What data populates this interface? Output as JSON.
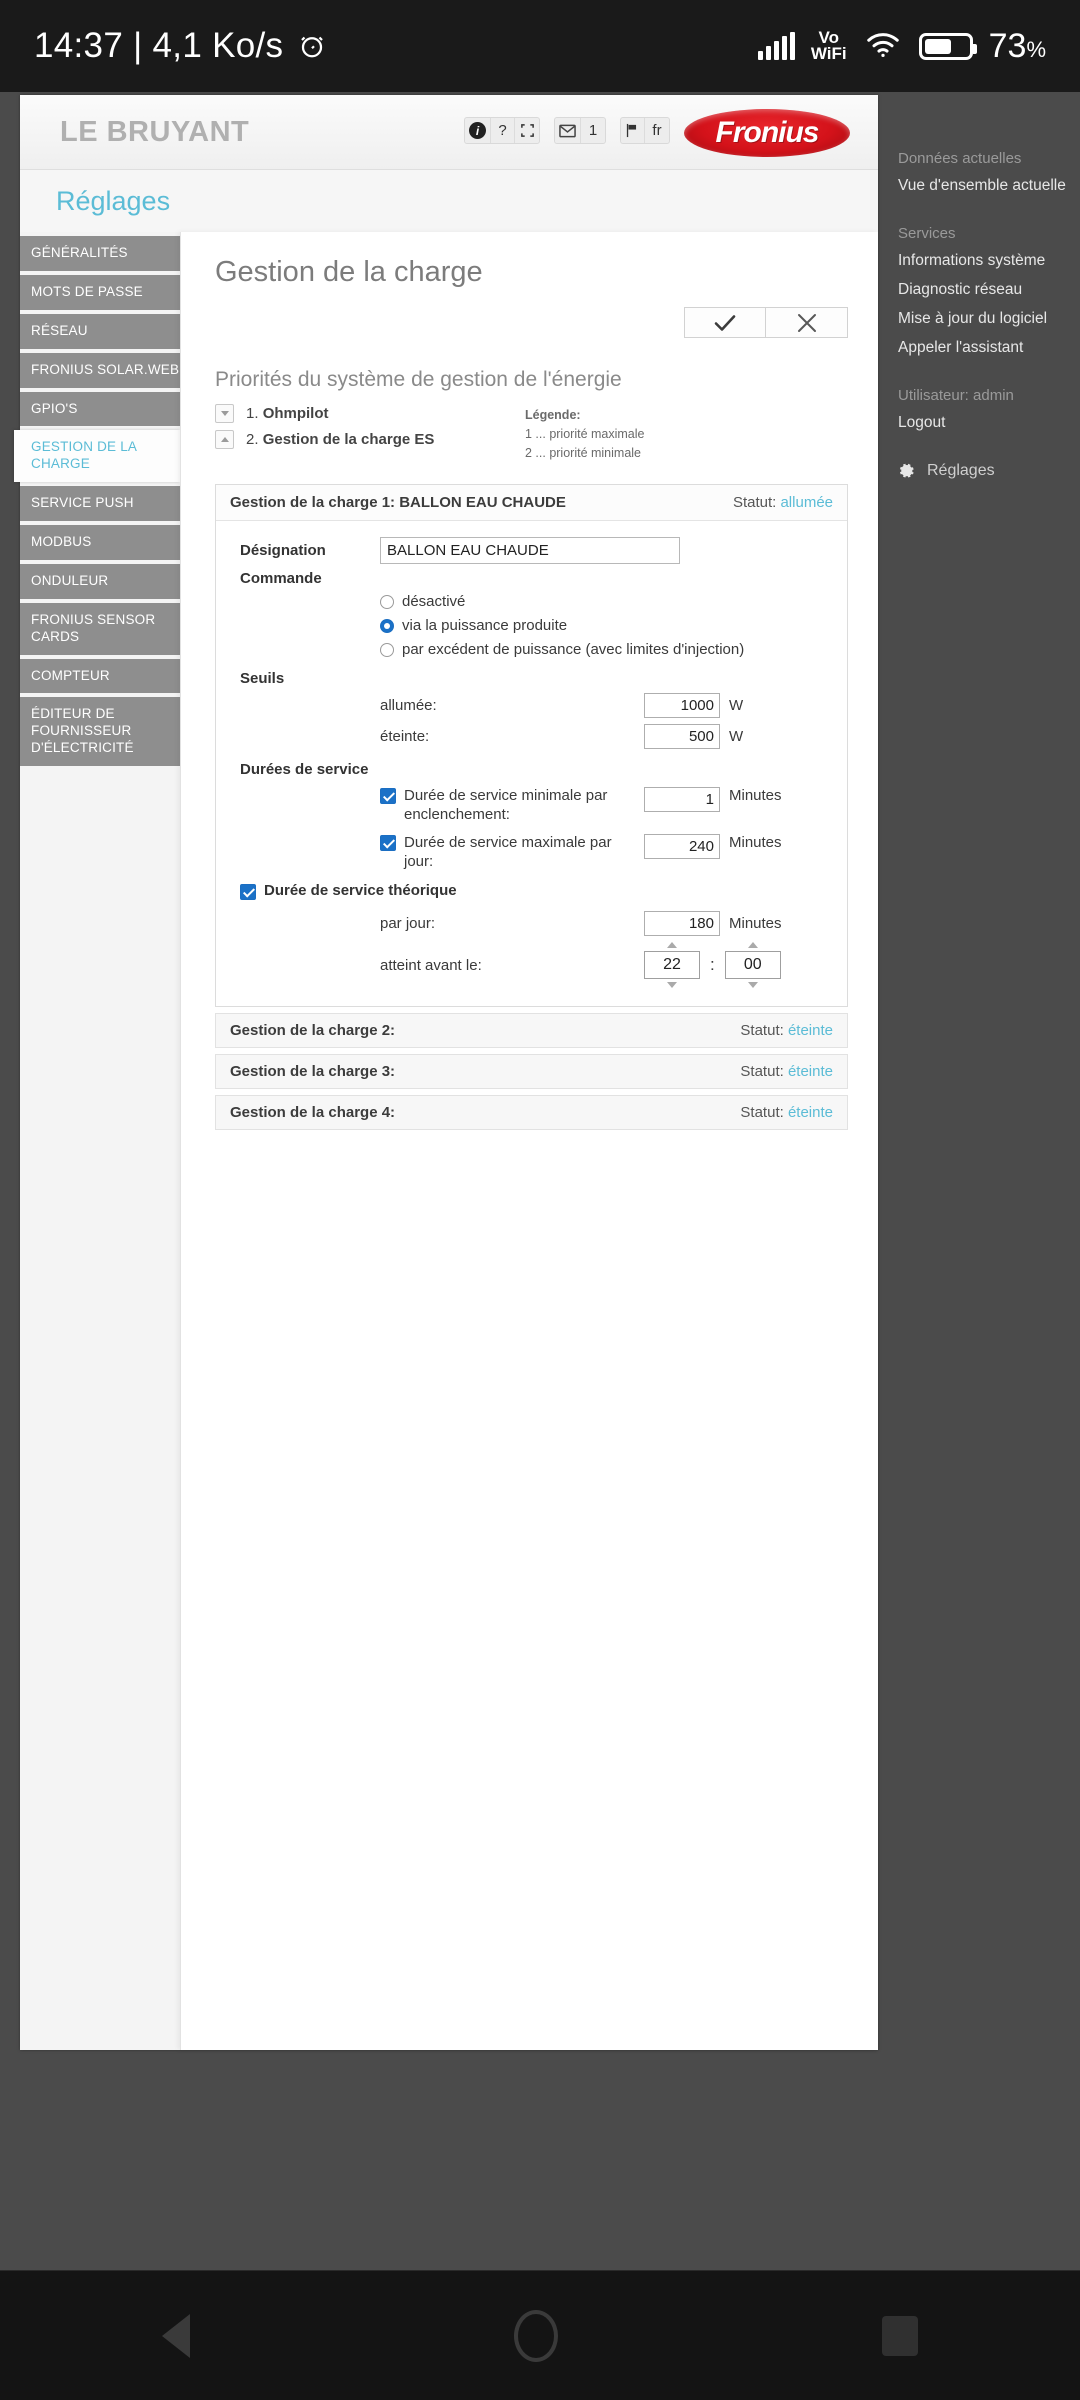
{
  "statusbar": {
    "clock": "14:37 | 4,1 Ko/s",
    "alarm_icon": "alarm-clock-icon",
    "signal_icon": "cellular-signal-icon",
    "vowifi_line1": "Vo",
    "vowifi_line2": "WiFi",
    "wifi_icon": "wifi-icon",
    "battery_icon": "battery-icon",
    "battery_percent": "73",
    "percent_sign": "%"
  },
  "header": {
    "site_title": "LE BRUYANT",
    "logo_text": "Fronius",
    "tools": [
      {
        "name": "info-icon",
        "label": "i"
      },
      {
        "name": "help-icon",
        "label": "?"
      },
      {
        "name": "expand-icon",
        "label": ""
      },
      {
        "name": "message-icon",
        "label": ""
      },
      {
        "name": "message-count",
        "label": "1"
      },
      {
        "name": "flag-icon",
        "label": ""
      },
      {
        "name": "language-code",
        "label": "fr"
      }
    ]
  },
  "tab": {
    "label": "Réglages"
  },
  "left_nav": [
    {
      "label": "GÉNÉRALITÉS",
      "active": false
    },
    {
      "label": "MOTS DE PASSE",
      "active": false
    },
    {
      "label": "RÉSEAU",
      "active": false
    },
    {
      "label": "FRONIUS SOLAR.WEB",
      "active": false
    },
    {
      "label": "GPIO'S",
      "active": false
    },
    {
      "label": "GESTION DE LA CHARGE",
      "active": true
    },
    {
      "label": "SERVICE PUSH",
      "active": false
    },
    {
      "label": "MODBUS",
      "active": false
    },
    {
      "label": "ONDULEUR",
      "active": false
    },
    {
      "label": "FRONIUS SENSOR CARDS",
      "active": false
    },
    {
      "label": "COMPTEUR",
      "active": false
    },
    {
      "label": "ÉDITEUR DE FOURNISSEUR D'ÉLECTRICITÉ",
      "active": false
    }
  ],
  "content": {
    "page_title": "Gestion de la charge",
    "ok_icon": "check-icon",
    "cancel_icon": "close-icon",
    "priorities_title": "Priorités du système de gestion de l'énergie",
    "priorities": [
      {
        "num": "1.",
        "name": "Ohmpilot",
        "arrow": "down"
      },
      {
        "num": "2.",
        "name": "Gestion de la charge ES",
        "arrow": "up"
      }
    ],
    "legend_head": "Légende:",
    "legend_lines": [
      "1 ... priorité maximale",
      "2 ... priorité minimale"
    ],
    "card": {
      "title": "Gestion de la charge 1: BALLON EAU CHAUDE",
      "status_label": "Statut:",
      "status_value": "allumée",
      "designation_label": "Désignation",
      "designation_value": "BALLON EAU CHAUDE",
      "commande_label": "Commande",
      "commande_options": [
        {
          "label": "désactivé",
          "selected": false
        },
        {
          "label": "via la puissance produite",
          "selected": true
        },
        {
          "label": "par excédent de puissance (avec limites d'injection)",
          "selected": false
        }
      ],
      "seuils_label": "Seuils",
      "seuils": [
        {
          "label": "allumée:",
          "value": "1000",
          "unit": "W"
        },
        {
          "label": "éteinte:",
          "value": "500",
          "unit": "W"
        }
      ],
      "durees_label": "Durées de service",
      "durees": [
        {
          "label": "Durée de service minimale par enclenchement:",
          "checked": true,
          "value": "1",
          "unit": "Minutes"
        },
        {
          "label": "Durée de service maximale par jour:",
          "checked": true,
          "value": "240",
          "unit": "Minutes"
        }
      ],
      "theorique_label": "Durée de service théorique",
      "theorique_checked": true,
      "par_jour_label": "par jour:",
      "par_jour_value": "180",
      "par_jour_unit": "Minutes",
      "atteint_label": "atteint avant le:",
      "atteint_hour": "22",
      "atteint_separator": ":",
      "atteint_minute": "00"
    },
    "collapsed": [
      {
        "title": "Gestion de la charge 2:",
        "status_label": "Statut:",
        "status_value": "éteinte"
      },
      {
        "title": "Gestion de la charge 3:",
        "status_label": "Statut:",
        "status_value": "éteinte"
      },
      {
        "title": "Gestion de la charge 4:",
        "status_label": "Statut:",
        "status_value": "éteinte"
      }
    ]
  },
  "right_nav": {
    "groups": [
      {
        "head": "Données actuelles",
        "items": [
          "Vue d'ensemble actuelle"
        ]
      },
      {
        "head": "Services",
        "items": [
          "Informations système",
          "Diagnostic réseau",
          "Mise à jour du logiciel",
          "Appeler l'assistant"
        ]
      },
      {
        "head": "Utilisateur: admin",
        "items": [
          "Logout"
        ]
      }
    ],
    "settings_label": "Réglages",
    "settings_icon": "gear-icon"
  },
  "navbar": {
    "back_icon": "back-triangle-icon",
    "home_icon": "home-circle-icon",
    "recents_icon": "recents-square-icon"
  },
  "colors": {
    "accent": "#5bbcd6",
    "brand_red": "#d4121a",
    "control_blue": "#1b71c7",
    "sidebar_gray": "#8e8e8e",
    "page_bg": "#4b4b4b"
  }
}
